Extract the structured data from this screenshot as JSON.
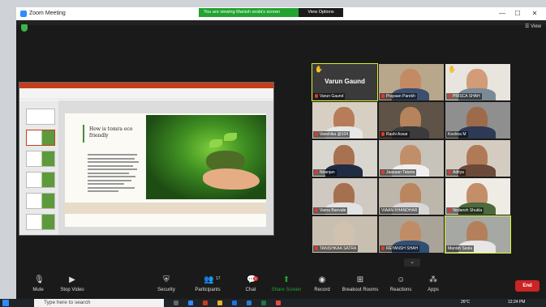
{
  "window": {
    "title": "Zoom Meeting",
    "banner": "You are viewing Manish sesla's screen",
    "view_options": "View Options",
    "view_label": "View",
    "minimize": "—",
    "maximize": "☐",
    "close": "✕"
  },
  "slide": {
    "title": "How is tomra eco friendly"
  },
  "gallery": {
    "speaker_big_name": "Varun Gaund",
    "tiles": [
      {
        "name": "Varun Gaund"
      },
      {
        "name": "Prayaan Parekh"
      },
      {
        "name": "PRISCA SHAH"
      },
      {
        "name": "Vanshika @104"
      },
      {
        "name": "Rashi Assar"
      },
      {
        "name": "Keshna M"
      },
      {
        "name": "Niranjan"
      },
      {
        "name": "Jaasaan Tataria"
      },
      {
        "name": "Aditya"
      },
      {
        "name": "Varna Banvale"
      },
      {
        "name": "VIAAN KHANDHAR"
      },
      {
        "name": "Vedansh Shukla"
      },
      {
        "name": "TANISHKAA SATRA"
      },
      {
        "name": "REYANSH SHAH"
      },
      {
        "name": "Manish Sesla"
      }
    ]
  },
  "toolbar": {
    "mute": "Mute",
    "stop_video": "Stop Video",
    "security": "Security",
    "participants": "Participants",
    "participants_count": "17",
    "chat": "Chat",
    "chat_badge": "1",
    "share_screen": "Share Screen",
    "record": "Record",
    "breakout_rooms": "Breakout Rooms",
    "reactions": "Reactions",
    "apps": "Apps",
    "end": "End"
  },
  "taskbar": {
    "search_placeholder": "Type here to search",
    "temperature": "26°C",
    "time": "12:24 PM"
  },
  "colors": {
    "zoom_blue": "#2d8cff",
    "banner_green": "#23a331",
    "end_red": "#cc2424",
    "active_speaker": "#d7f12f"
  }
}
